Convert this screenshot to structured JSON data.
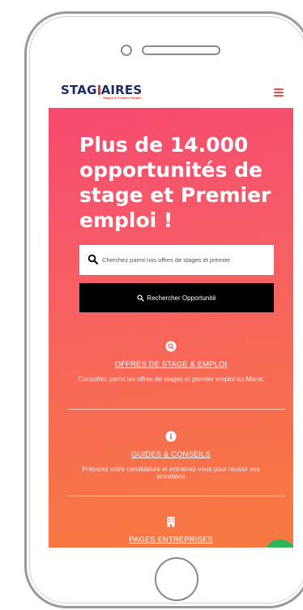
{
  "header": {
    "logo_text_left": "STAG",
    "logo_text_right": "AIRES",
    "logo_tagline": "Stages & Premier Emploi",
    "menu_icon": "hamburger-icon"
  },
  "hero": {
    "headline": "Plus de 14.000 opportunités de stage et Premier emploi !"
  },
  "search": {
    "placeholder": "Cherchez parmi nos offres de stages et premier",
    "button_label": "Rechercher Opportunité",
    "icon": "search-icon"
  },
  "features": [
    {
      "icon": "search-badge-icon",
      "title": "OFFRES DE STAGE & EMPLOI",
      "description": "Consultez parmi les offres de stages et premier emploi au Maroc"
    },
    {
      "icon": "info-icon",
      "title": "GUIDES & CONSEILS",
      "description": "Préparez votre candidature et entrainez-vous pour réussir vos entretiens"
    },
    {
      "icon": "building-icon",
      "title": "PAGES ENTREPRISES",
      "description": ""
    }
  ],
  "colors": {
    "brand_navy": "#1d2a6b",
    "brand_red": "#e5332a",
    "gradient_start": "#f74a6e",
    "gradient_end": "#f77a3f",
    "chat_green": "#2cb55a"
  }
}
